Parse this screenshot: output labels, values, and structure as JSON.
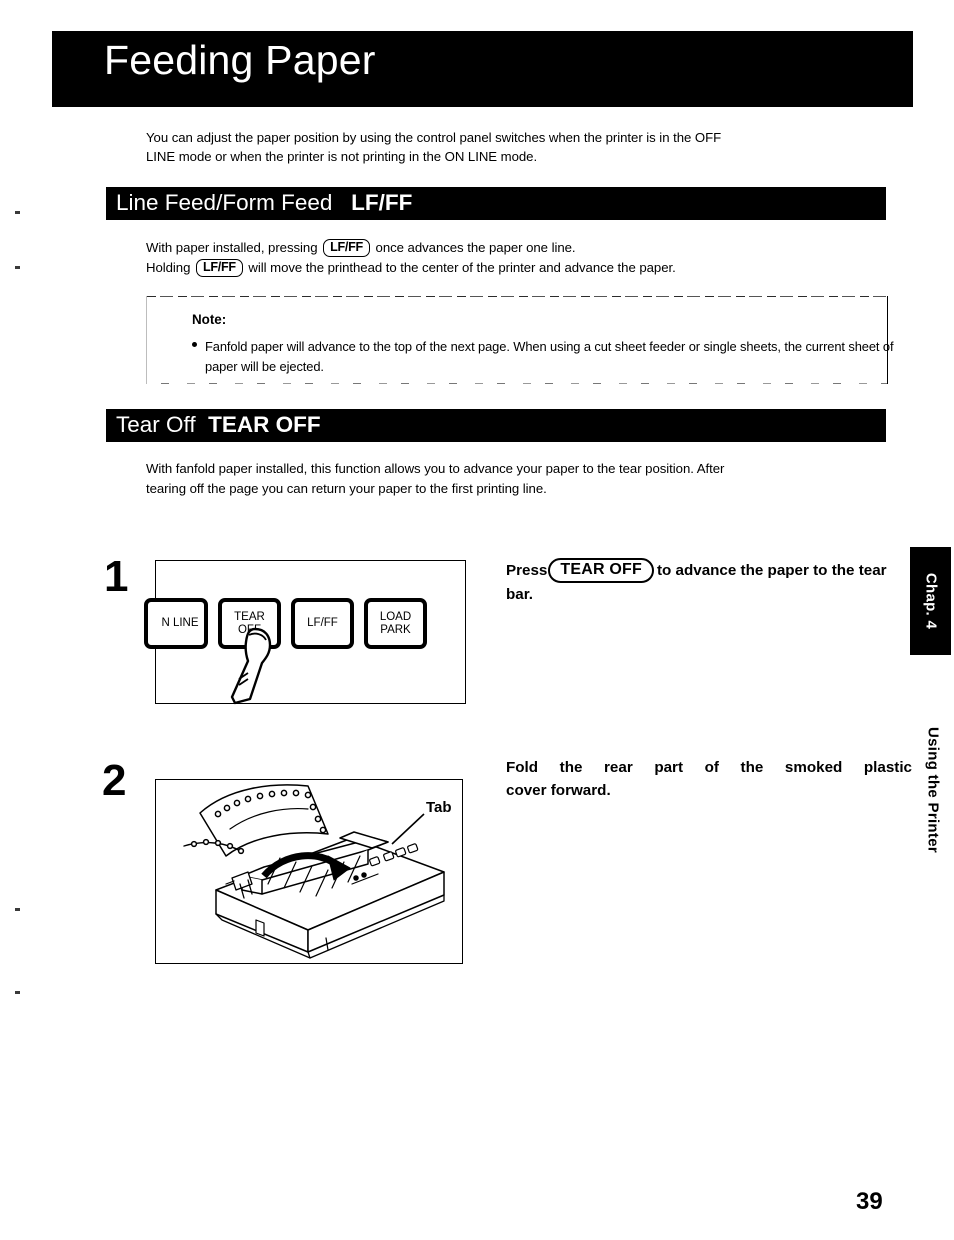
{
  "page": {
    "title": "Feeding Paper",
    "number": "39",
    "chapter_tab": "Chap. 4",
    "chapter_label": "Using the Printer"
  },
  "intro": {
    "line1": "You can adjust the paper position by using the control panel switches when the printer is in the OFF",
    "line2": "LINE mode or when the printer is not printing in the ON LINE mode."
  },
  "sections": [
    {
      "id": "line-feed-form-feed",
      "name": "Line Feed/Form Feed",
      "code": "LF/FF",
      "paragraph": {
        "line1_pre": "With paper installed, pressing",
        "line1_key": "LF/FF",
        "line1_post": "once advances the paper one line.",
        "line2_pre": "Holding",
        "line2_key": "LF/FF",
        "line2_post": "will move the printhead to the center of the printer and advance the paper."
      },
      "note": {
        "label": "Note:",
        "bullet": "Fanfold paper will advance to the top of the next page. When using a cut sheet feeder or single sheets, the current sheet of paper will be ejected."
      }
    },
    {
      "id": "tear-off",
      "name": "Tear Off",
      "code": "TEAR OFF",
      "paragraph": {
        "line1": "With fanfold paper installed, this function allows you to advance your paper to the tear position. After",
        "line2": "tearing off the page you can return your paper to the first printing line."
      }
    }
  ],
  "steps": [
    {
      "number": "1",
      "text_pre": "Press",
      "text_key": "TEAR OFF",
      "text_post": "to advance the paper to the tear bar.",
      "text_line1_post": "to advance the paper to",
      "text_line2": "the tear bar.",
      "figure": {
        "type": "control-panel",
        "buttons": [
          {
            "id": "on-line",
            "label": "N LINE"
          },
          {
            "id": "tear-off",
            "label": "TEAR\nOFF"
          },
          {
            "id": "lf-ff",
            "label": "LF/FF"
          },
          {
            "id": "load-park",
            "label": "LOAD\nPARK"
          }
        ],
        "pointer": "finger pressing TEAR OFF"
      }
    },
    {
      "number": "2",
      "text_line1": "Fold the rear part of the smoked plastic",
      "text_line2": "cover forward.",
      "figure": {
        "type": "printer-illustration",
        "callout": "Tab"
      }
    }
  ],
  "colors": {
    "ink": "#000000",
    "paper": "#ffffff"
  }
}
